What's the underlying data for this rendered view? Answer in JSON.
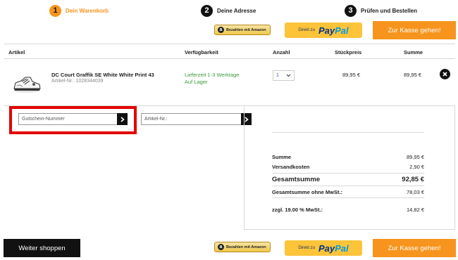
{
  "steps": [
    {
      "number": "1",
      "label": "Dein Warenkorb"
    },
    {
      "number": "2",
      "label": "Deine Adresse"
    },
    {
      "number": "3",
      "label": "Prüfen und Bestellen"
    }
  ],
  "payments": {
    "amazon_logo": "a",
    "amazon_label": "Bezahlen mit Amazon",
    "paypal_prefix": "Direkt zu",
    "paypal_pay": "Pay",
    "paypal_pal": "Pal",
    "checkout_label": "Zur Kasse gehen!"
  },
  "table": {
    "headers": {
      "article": "Artikel",
      "availability": "Verfügbarkeit",
      "quantity": "Anzahl",
      "unit_price": "Stückpreis",
      "total": "Summe"
    },
    "item": {
      "name": "DC Court Graffik SE White White Print 43",
      "sku": "Artikel-Nr.: 1028344039",
      "availability_line1": "Lieferzeit 1-3 Werktage",
      "availability_line2": "Auf Lager",
      "quantity": "1",
      "unit_price": "89,95 €",
      "total": "89,95 €",
      "remove_icon": "close-icon"
    }
  },
  "voucher": {
    "placeholder": "Gutschein-Nummer",
    "article_placeholder": "Artikel-Nr.:"
  },
  "summary": {
    "subtotal_label": "Summe",
    "subtotal_value": "89,95 €",
    "shipping_label": "Versandkosten",
    "shipping_value": "2,90 €",
    "grand_total_label": "Gesamtsumme",
    "grand_total_value": "92,85 €",
    "net_label": "Gesamtsumme ohne MwSt.:",
    "net_value": "78,03 €",
    "vat_label": "zzgl. 19.00 % MwSt.:",
    "vat_value": "14,82 €"
  },
  "footer": {
    "continue_label": "Weiter shoppen"
  },
  "colors": {
    "accent": "#f7941d",
    "highlight": "#e30000",
    "availability": "#3c9a3c"
  }
}
